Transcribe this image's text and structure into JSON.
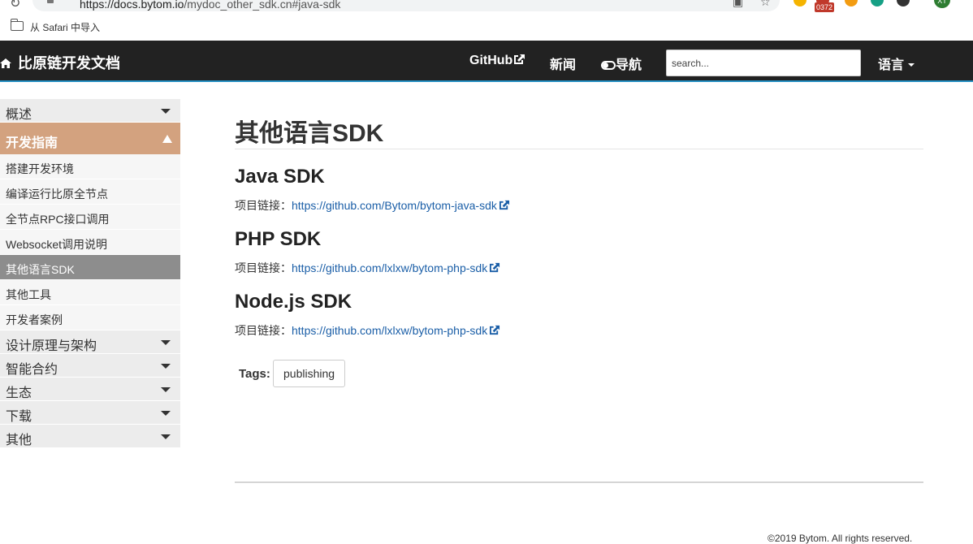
{
  "browser": {
    "url_host": "https://docs.bytom.io",
    "url_path": "/mydoc_other_sdk.cn#java-sdk",
    "badge_count": "0372",
    "avatar_initials": "XT"
  },
  "bookmarks": {
    "import_label": "从 Safari 中导入"
  },
  "navbar": {
    "brand": "比原链开发文档",
    "github": "GitHub",
    "news": "新闻",
    "nav_toggle": "导航",
    "search_placeholder": "search...",
    "language": "语言"
  },
  "sidebar": {
    "items": [
      {
        "label": "概述"
      },
      {
        "label": "开发指南"
      },
      {
        "label": "搭建开发环境"
      },
      {
        "label": "编译运行比原全节点"
      },
      {
        "label": "全节点RPC接口调用"
      },
      {
        "label": "Websocket调用说明"
      },
      {
        "label": "其他语言SDK"
      },
      {
        "label": "其他工具"
      },
      {
        "label": "开发者案例"
      },
      {
        "label": "设计原理与架构"
      },
      {
        "label": "智能合约"
      },
      {
        "label": "生态"
      },
      {
        "label": "下载"
      },
      {
        "label": "其他"
      }
    ]
  },
  "main": {
    "title": "其他语言SDK",
    "sections": [
      {
        "heading": "Java SDK",
        "link_prefix": "项目链接：",
        "link": "https://github.com/Bytom/bytom-java-sdk"
      },
      {
        "heading": "PHP SDK",
        "link_prefix": "项目链接：",
        "link": "https://github.com/lxlxw/bytom-php-sdk"
      },
      {
        "heading": "Node.js SDK",
        "link_prefix": "项目链接：",
        "link": "https://github.com/lxlxw/bytom-php-sdk"
      }
    ],
    "tags_label": "Tags:",
    "tag": "publishing"
  },
  "footer": {
    "copyright": "©2019 Bytom. All rights reserved."
  },
  "colors": {
    "navbar_bg": "#222222",
    "nav_accent": "#248ec2",
    "sidebar_active": "#d3a27f",
    "sidebar_current": "#8d8d8d",
    "link": "#1a5ea7"
  }
}
